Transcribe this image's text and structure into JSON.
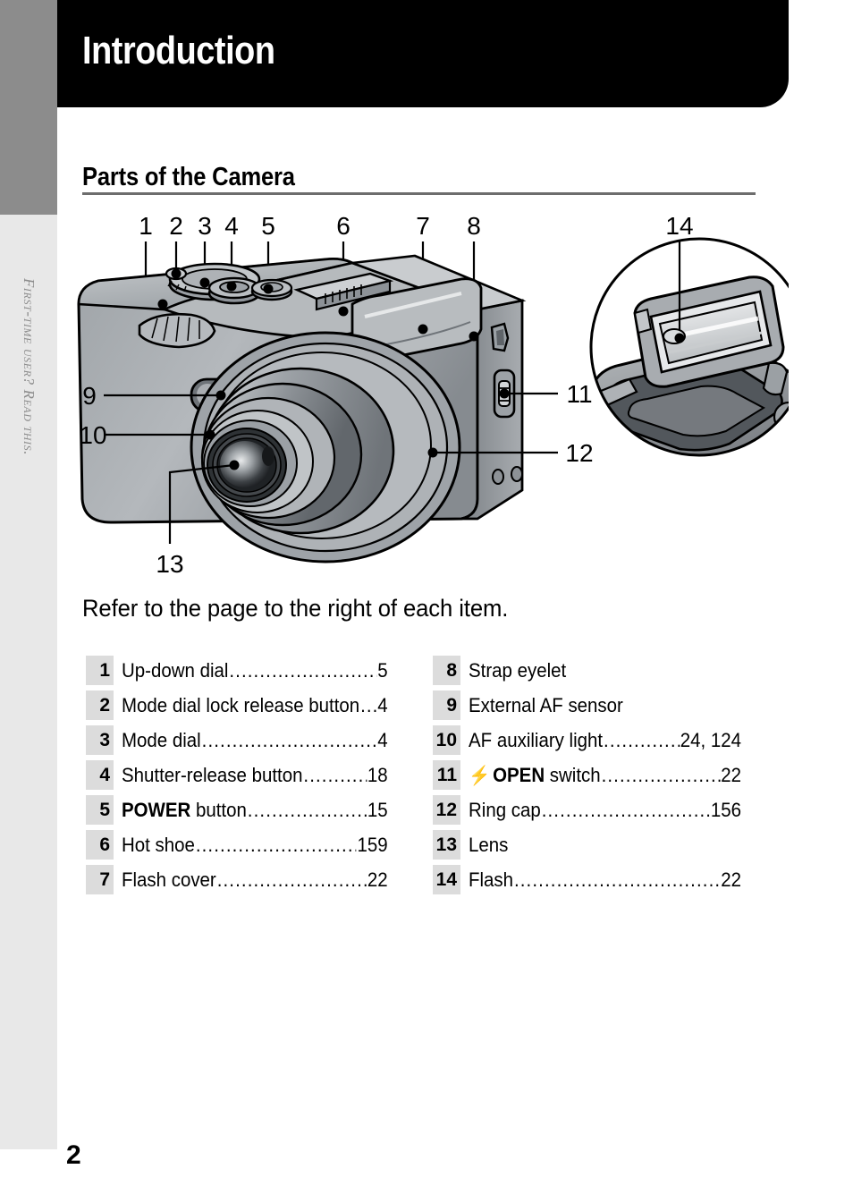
{
  "edge_tab": {
    "label": "First-time user? Read this."
  },
  "header": {
    "title": "Introduction"
  },
  "section": {
    "title": "Parts of the Camera"
  },
  "intro": {
    "text": "Refer to the page to the right of each item."
  },
  "figure": {
    "main_callouts": [
      "1",
      "2",
      "3",
      "4",
      "5",
      "6",
      "7",
      "8",
      "9",
      "10",
      "11",
      "12",
      "13"
    ],
    "inset_callout": "14",
    "description": "Front three-quarter view of a compact digital camera with extended zoom lens, and a circular inset detail showing the raised pop-up flash"
  },
  "parts": {
    "left": [
      {
        "num": "1",
        "label": "Up-down dial",
        "bold": "",
        "page": "5"
      },
      {
        "num": "2",
        "label": "Mode dial lock release button ",
        "bold": "",
        "page": "4"
      },
      {
        "num": "3",
        "label": "Mode dial ",
        "bold": "",
        "page": "4"
      },
      {
        "num": "4",
        "label": "Shutter-release button",
        "bold": "",
        "page": "18"
      },
      {
        "num": "5",
        "label": " button ",
        "bold": "POWER",
        "page": "15"
      },
      {
        "num": "6",
        "label": "Hot shoe ",
        "bold": "",
        "page": "159"
      },
      {
        "num": "7",
        "label": "Flash cover",
        "bold": "",
        "page": "22"
      }
    ],
    "right": [
      {
        "num": "8",
        "label": "Strap eyelet",
        "bold": "",
        "page": "",
        "bolt": false
      },
      {
        "num": "9",
        "label": "External AF sensor",
        "bold": "",
        "page": "",
        "bolt": false
      },
      {
        "num": "10",
        "label": "AF auxiliary light ",
        "bold": "",
        "page": "24, 124",
        "bolt": false
      },
      {
        "num": "11",
        "label": " switch ",
        "bold": "OPEN",
        "page": "22",
        "bolt": true
      },
      {
        "num": "12",
        "label": "Ring cap ",
        "bold": "",
        "page": "156",
        "bolt": false
      },
      {
        "num": "13",
        "label": "Lens",
        "bold": "",
        "page": "",
        "bolt": false
      },
      {
        "num": "14",
        "label": "Flash",
        "bold": "",
        "page": "22",
        "bolt": false
      }
    ]
  },
  "folio": {
    "page_number": "2"
  },
  "colors": {
    "header_bg": "#000000",
    "edge_tab_dark": "#8c8c8c",
    "edge_tab_light": "#e8e8e8",
    "badge_bg": "#dcdcdc",
    "rule": "#6d6d6d"
  }
}
